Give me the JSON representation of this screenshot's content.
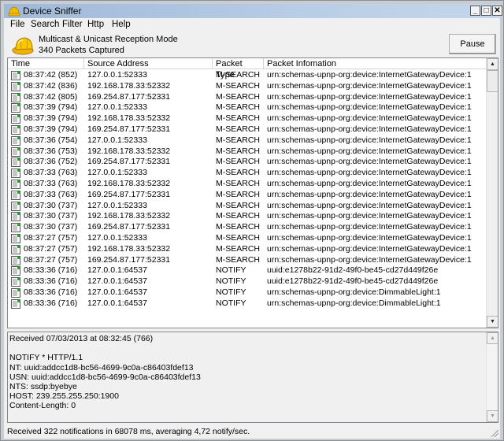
{
  "window": {
    "title": "Device Sniffer",
    "controls": {
      "minimize": "_",
      "maximize": "□",
      "close": "✕"
    }
  },
  "menu": [
    "File",
    "Search",
    "Filter",
    "Http",
    "Help"
  ],
  "status": {
    "mode": "Multicast & Unicast Reception Mode",
    "captured": "340 Packets Captured",
    "icon": "hard-hat-icon"
  },
  "pause_label": "Pause",
  "table": {
    "columns": [
      "Time",
      "Source Address",
      "Packet Type",
      "Packet Infomation"
    ],
    "row_icon": "document-icon",
    "rows": [
      [
        "08:37:42 (852)",
        "127.0.0.1:52333",
        "M-SEARCH",
        "urn:schemas-upnp-org:device:InternetGatewayDevice:1"
      ],
      [
        "08:37:42 (836)",
        "192.168.178.33:52332",
        "M-SEARCH",
        "urn:schemas-upnp-org:device:InternetGatewayDevice:1"
      ],
      [
        "08:37:42 (805)",
        "169.254.87.177:52331",
        "M-SEARCH",
        "urn:schemas-upnp-org:device:InternetGatewayDevice:1"
      ],
      [
        "08:37:39 (794)",
        "127.0.0.1:52333",
        "M-SEARCH",
        "urn:schemas-upnp-org:device:InternetGatewayDevice:1"
      ],
      [
        "08:37:39 (794)",
        "192.168.178.33:52332",
        "M-SEARCH",
        "urn:schemas-upnp-org:device:InternetGatewayDevice:1"
      ],
      [
        "08:37:39 (794)",
        "169.254.87.177:52331",
        "M-SEARCH",
        "urn:schemas-upnp-org:device:InternetGatewayDevice:1"
      ],
      [
        "08:37:36 (754)",
        "127.0.0.1:52333",
        "M-SEARCH",
        "urn:schemas-upnp-org:device:InternetGatewayDevice:1"
      ],
      [
        "08:37:36 (753)",
        "192.168.178.33:52332",
        "M-SEARCH",
        "urn:schemas-upnp-org:device:InternetGatewayDevice:1"
      ],
      [
        "08:37:36 (752)",
        "169.254.87.177:52331",
        "M-SEARCH",
        "urn:schemas-upnp-org:device:InternetGatewayDevice:1"
      ],
      [
        "08:37:33 (763)",
        "127.0.0.1:52333",
        "M-SEARCH",
        "urn:schemas-upnp-org:device:InternetGatewayDevice:1"
      ],
      [
        "08:37:33 (763)",
        "192.168.178.33:52332",
        "M-SEARCH",
        "urn:schemas-upnp-org:device:InternetGatewayDevice:1"
      ],
      [
        "08:37:33 (763)",
        "169.254.87.177:52331",
        "M-SEARCH",
        "urn:schemas-upnp-org:device:InternetGatewayDevice:1"
      ],
      [
        "08:37:30 (737)",
        "127.0.0.1:52333",
        "M-SEARCH",
        "urn:schemas-upnp-org:device:InternetGatewayDevice:1"
      ],
      [
        "08:37:30 (737)",
        "192.168.178.33:52332",
        "M-SEARCH",
        "urn:schemas-upnp-org:device:InternetGatewayDevice:1"
      ],
      [
        "08:37:30 (737)",
        "169.254.87.177:52331",
        "M-SEARCH",
        "urn:schemas-upnp-org:device:InternetGatewayDevice:1"
      ],
      [
        "08:37:27 (757)",
        "127.0.0.1:52333",
        "M-SEARCH",
        "urn:schemas-upnp-org:device:InternetGatewayDevice:1"
      ],
      [
        "08:37:27 (757)",
        "192.168.178.33:52332",
        "M-SEARCH",
        "urn:schemas-upnp-org:device:InternetGatewayDevice:1"
      ],
      [
        "08:37:27 (757)",
        "169.254.87.177:52331",
        "M-SEARCH",
        "urn:schemas-upnp-org:device:InternetGatewayDevice:1"
      ],
      [
        "08:33:36 (716)",
        "127.0.0.1:64537",
        "NOTIFY",
        "uuid:e1278b22-91d2-49f0-be45-cd27d449f26e"
      ],
      [
        "08:33:36 (716)",
        "127.0.0.1:64537",
        "NOTIFY",
        "uuid:e1278b22-91d2-49f0-be45-cd27d449f26e"
      ],
      [
        "08:33:36 (716)",
        "127.0.0.1:64537",
        "NOTIFY",
        "urn:schemas-upnp-org:device:DimmableLight:1"
      ],
      [
        "08:33:36 (716)",
        "127.0.0.1:64537",
        "NOTIFY",
        "urn:schemas-upnp-org:device:DimmableLight:1"
      ]
    ],
    "scroll_position": 0.0
  },
  "detail": {
    "text": "Received 07/03/2013 at 08:32:45 (766)\n\nNOTIFY * HTTP/1.1\nNT: uuid:addcc1d8-bc56-4699-9c0a-c86403fdef13\nUSN: uuid:addcc1d8-bc56-4699-9c0a-c86403fdef13\nNTS: ssdp:byebye\nHOST: 239.255.255.250:1900\nContent-Length: 0"
  },
  "statusbar": {
    "text": "Received 322 notifications in 68078 ms, averaging 4,72 notify/sec."
  }
}
